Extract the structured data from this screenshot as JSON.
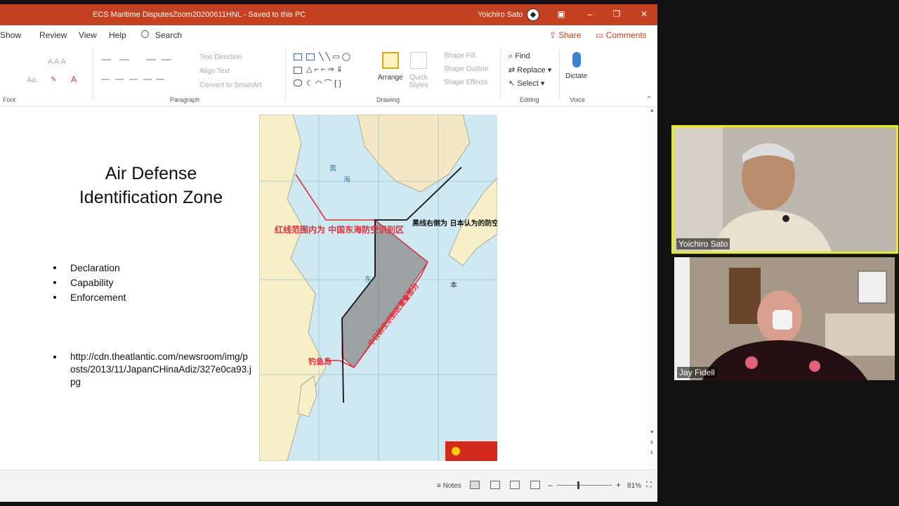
{
  "titlebar": {
    "title": "ECS Maritime DisputesZoom20200611HNL  -  Saved to this PC",
    "user": "Yoichiro Sato",
    "accent": "#c4401f"
  },
  "tabs": {
    "items": [
      "Show",
      "Review",
      "View",
      "Help"
    ],
    "search": "Search",
    "share": "Share",
    "comments": "Comments"
  },
  "ribbon": {
    "font_label": "Font",
    "paragraph_label": "Paragraph",
    "drawing_label": "Drawing",
    "editing_label": "Editing",
    "voice_label": "Voice",
    "text_direction": "Text Direction",
    "align_text": "Align Text",
    "convert_smartart": "Convert to SmartArt",
    "arrange": "Arrange",
    "quick_styles": "Quick Styles",
    "shape_fill": "Shape Fill",
    "shape_outline": "Shape Outline",
    "shape_effects": "Shape Effects",
    "find": "Find",
    "replace": "Replace",
    "select": "Select",
    "dictate": "Dictate"
  },
  "slide": {
    "title_line1": "Air Defense",
    "title_line2": "Identification Zone",
    "bullets": [
      "Declaration",
      "Capability",
      "Enforcement"
    ],
    "url": "http://cdn.theatlantic.com/newsroom/img/posts/2013/11/JapanCHinaAdiz/327e0ca93.jpg",
    "map": {
      "red_label": "红线范围内为 中国东海防空识别区",
      "black_label": "黑线右侧为 日本认为的防空识别区",
      "overlap_label": "中日防空识别区重叠部分",
      "island_label": "钓鱼岛",
      "sea_label_1": "黄",
      "sea_label_2": "海",
      "sea_label_3": "东",
      "sea_label_4": "本"
    }
  },
  "statusbar": {
    "notes": "Notes",
    "zoom": "81%"
  },
  "participants": [
    {
      "name": "Yoichiro Sato",
      "active": true
    },
    {
      "name": "Jay Fidell",
      "active": false
    }
  ]
}
